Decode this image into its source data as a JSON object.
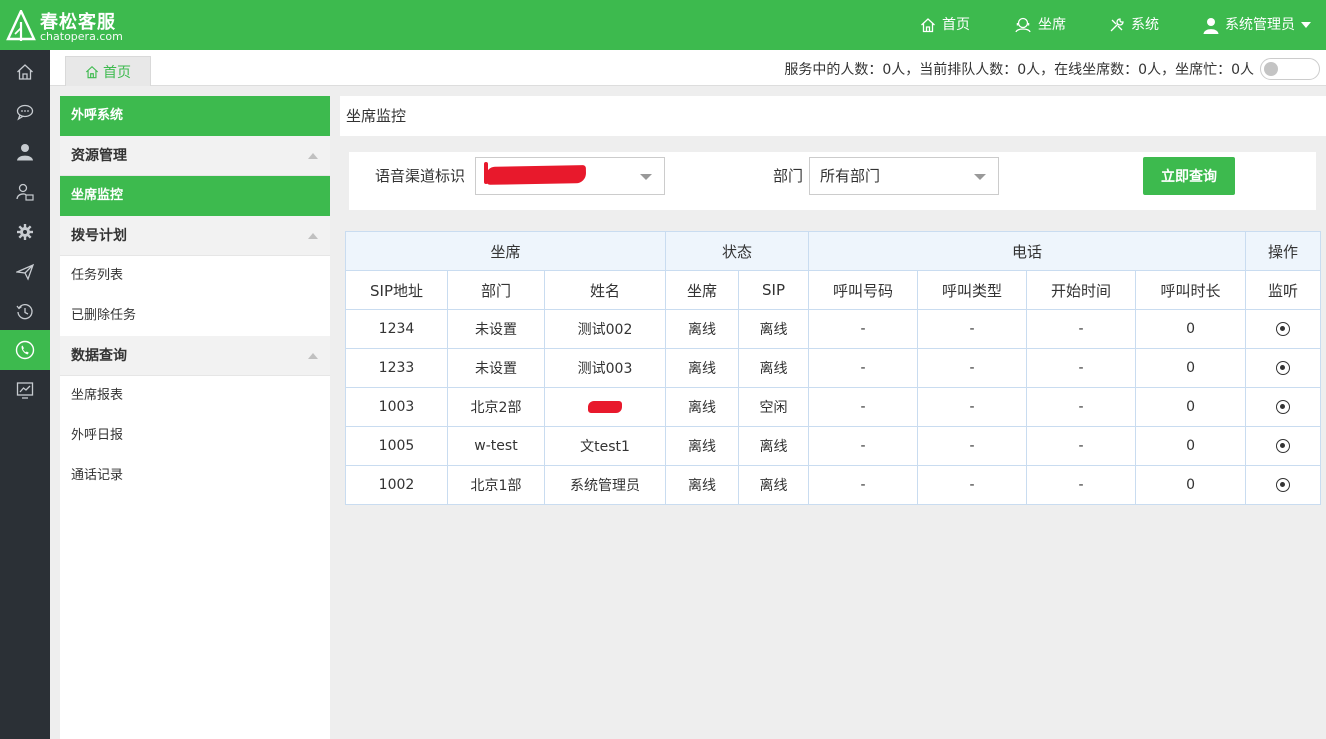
{
  "brand": {
    "title": "春松客服",
    "subtitle": "chatopera.com"
  },
  "topnav": {
    "home": "首页",
    "agent": "坐席",
    "system": "系统",
    "user": "系统管理员"
  },
  "rail": [
    "home-icon",
    "chat-icon",
    "user-icon",
    "contacts-icon",
    "gear-icon",
    "send-icon",
    "history-icon",
    "phone-icon",
    "chart-icon"
  ],
  "tabs": {
    "home": "首页"
  },
  "stats_text": "服务中的人数：0人，当前排队人数：0人，在线坐席数：0人，坐席忙：0人",
  "menu": {
    "outbound": "外呼系统",
    "resource": "资源管理",
    "agent_monitor": "坐席监控",
    "dial_plan": "拨号计划",
    "task_list": "任务列表",
    "deleted_tasks": "已删除任务",
    "data_query": "数据查询",
    "agent_report": "坐席报表",
    "outbound_daily": "外呼日报",
    "call_records": "通话记录"
  },
  "panel": {
    "title": "坐席监控"
  },
  "filter": {
    "channel_label": "语音渠道标识",
    "dept_label": "部门",
    "dept_value": "所有部门",
    "query_button": "立即查询"
  },
  "table": {
    "group_headers": [
      "坐席",
      "状态",
      "电话",
      "操作"
    ],
    "columns": [
      "SIP地址",
      "部门",
      "姓名",
      "坐席",
      "SIP",
      "呼叫号码",
      "呼叫类型",
      "开始时间",
      "呼叫时长",
      "监听"
    ],
    "rows": [
      [
        "1234",
        "未设置",
        "测试002",
        "离线",
        "离线",
        "-",
        "-",
        "-",
        "0"
      ],
      [
        "1233",
        "未设置",
        "测试003",
        "离线",
        "离线",
        "-",
        "-",
        "-",
        "0"
      ],
      [
        "1003",
        "北京2部",
        "",
        "离线",
        "空闲",
        "-",
        "-",
        "-",
        "0"
      ],
      [
        "1005",
        "w-test",
        "文test1",
        "离线",
        "离线",
        "-",
        "-",
        "-",
        "0"
      ],
      [
        "1002",
        "北京1部",
        "系统管理员",
        "离线",
        "离线",
        "-",
        "-",
        "-",
        "0"
      ]
    ]
  },
  "colors": {
    "accent": "#3dba4e",
    "rail": "#2b3036",
    "redaction": "#e8192c"
  }
}
